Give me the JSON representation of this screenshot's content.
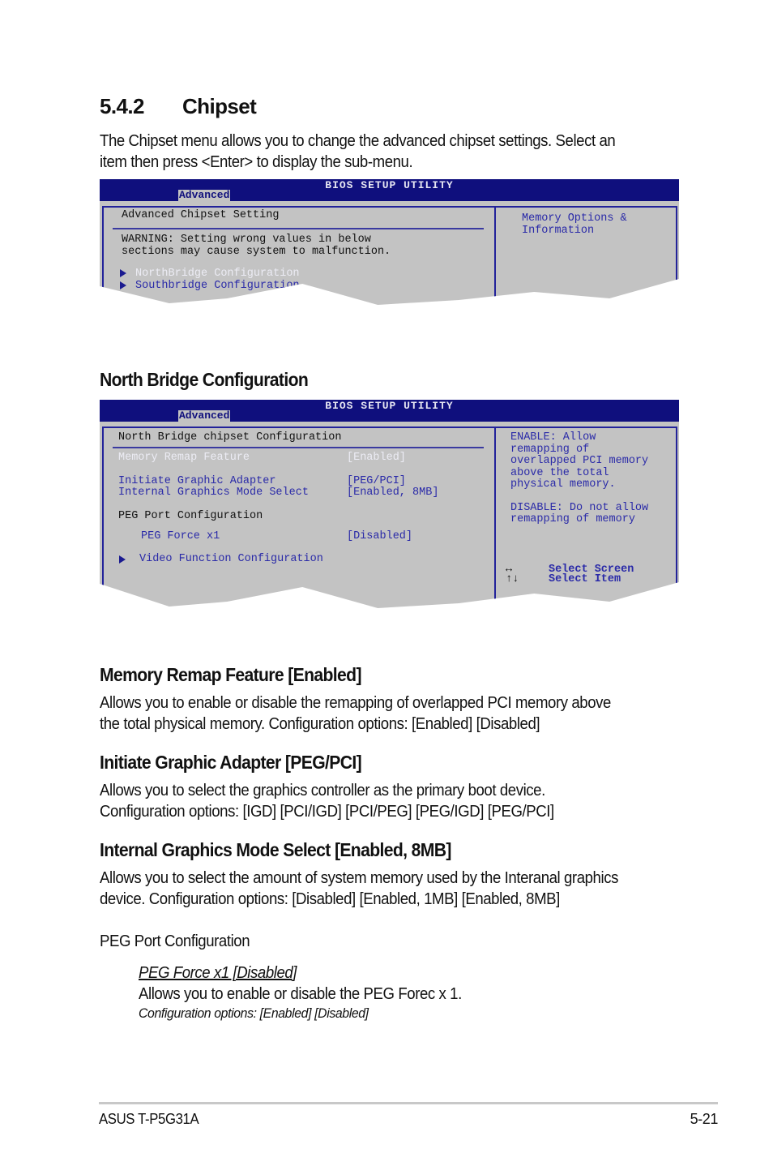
{
  "section": {
    "number": "5.4.2",
    "title": "Chipset"
  },
  "intro_lines": [
    "The Chipset menu allows you to change the advanced chipset settings. Select an",
    "item then press <Enter> to display the sub-menu."
  ],
  "bios1": {
    "title": "BIOS SETUP UTILITY",
    "tab": "Advanced",
    "heading": "Advanced Chipset Setting",
    "warning_lines": [
      "WARNING: Setting wrong values in below",
      "sections may cause system to malfunction."
    ],
    "items": [
      "NorthBridge Configuration",
      "Southbridge Configuration"
    ],
    "help_lines": [
      "Memory Options &",
      "Information"
    ]
  },
  "nb_heading": "North Bridge Configuration",
  "bios2": {
    "title": "BIOS SETUP UTILITY",
    "tab": "Advanced",
    "heading": "North Bridge chipset Configuration",
    "rows": [
      {
        "label": "Memory Remap Feature",
        "value": "[Enabled]"
      },
      {
        "label": "Initiate Graphic Adapter",
        "value": "[PEG/PCI]"
      },
      {
        "label": "Internal Graphics Mode Select",
        "value": "[Enabled, 8MB]"
      }
    ],
    "peg_heading": "PEG Port Configuration",
    "peg_row": {
      "label": "PEG Force x1",
      "value": "[Disabled]"
    },
    "submenu": "Video Function Configuration",
    "help_lines": [
      "ENABLE: Allow",
      "remapping of",
      "overlapped PCI memory",
      "above the total",
      "physical memory.",
      "",
      "DISABLE: Do not allow",
      "remapping of memory"
    ],
    "keys": [
      {
        "key": "↔",
        "label": "Select Screen"
      },
      {
        "key": "↑↓",
        "label": "Select Item"
      }
    ]
  },
  "options": [
    {
      "title": "Memory Remap Feature [Enabled]",
      "lines": [
        "Allows you to enable or disable the  remapping of overlapped PCI memory above",
        "the total physical memory. Configuration options: [Enabled] [Disabled]"
      ]
    },
    {
      "title": "Initiate Graphic Adapter [PEG/PCI]",
      "lines": [
        "Allows you to select the graphics controller as the primary boot device.",
        "Configuration options: [IGD] [PCI/IGD] [PCI/PEG] [PEG/IGD] [PEG/PCI]"
      ]
    },
    {
      "title": "Internal Graphics Mode Select [Enabled, 8MB]",
      "lines": [
        "Allows you to select the amount of system memory used by the Interanal graphics",
        "device. Configuration options: [Disabled] [Enabled, 1MB] [Enabled, 8MB]"
      ]
    }
  ],
  "peg": {
    "heading": "PEG Port Configuration",
    "item_title": "PEG Force x1 [Disabled]",
    "item_desc": "Allows you to enable or disable the PEG Forec x 1.",
    "item_options": "Configuration options: [Enabled] [Disabled]"
  },
  "footer": {
    "left": "ASUS T-P5G31A",
    "right": "5-21"
  }
}
